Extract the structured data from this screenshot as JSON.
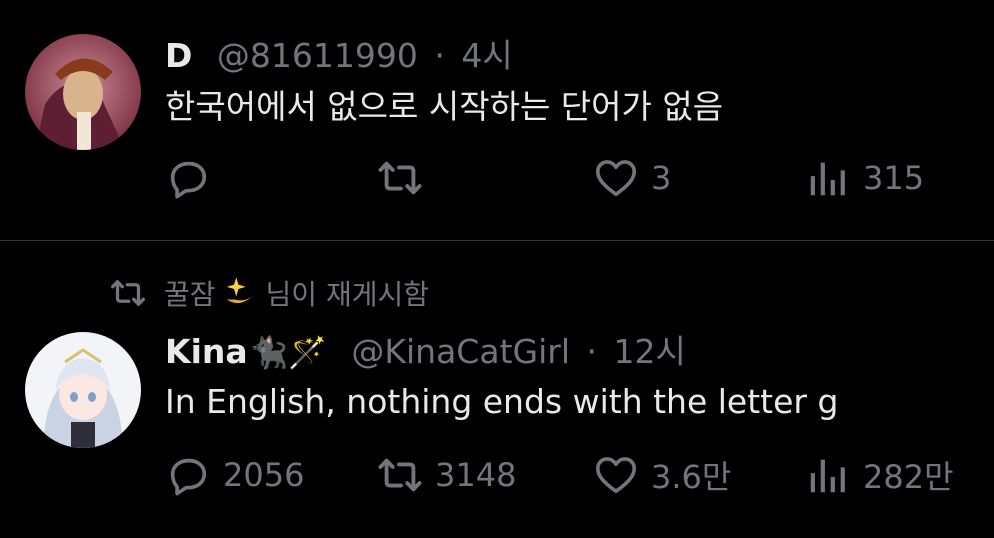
{
  "tweets": [
    {
      "author_name": "D",
      "handle": "@81611990",
      "separator": "·",
      "time": "4시",
      "text": "한국어에서 없으로 시작하는 단어가 없음",
      "actions": {
        "reply_count": "",
        "retweet_count": "",
        "like_count": "3",
        "view_count": "315"
      }
    },
    {
      "repost_by_name": "꿀잠",
      "repost_suffix": "님이 재게시함",
      "author_name": "Kina",
      "author_emoji": "🐈‍⬛🪄",
      "handle": "@KinaCatGirl",
      "separator": "·",
      "time": "12시",
      "text": "In English, nothing ends with the letter g",
      "actions": {
        "reply_count": "2056",
        "retweet_count": "3148",
        "like_count": "3.6만",
        "view_count": "282만"
      }
    }
  ],
  "icons": {
    "reply": "speech-bubble-icon",
    "retweet": "retweet-arrows-icon",
    "like": "heart-icon",
    "views": "bar-chart-icon",
    "repost_badge": "sparkle-dizzy-icon"
  },
  "colors": {
    "background": "#000000",
    "primary_text": "#e7e9ea",
    "secondary_text": "#71767b",
    "divider": "#2f3336"
  }
}
